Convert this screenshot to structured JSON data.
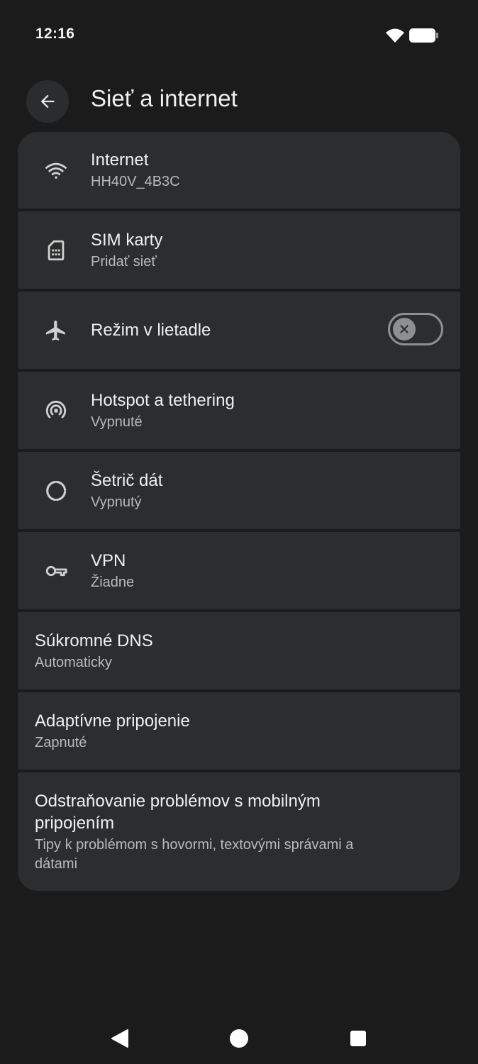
{
  "status_bar": {
    "time": "12:16",
    "wifi_icon": "wifi-icon",
    "battery_icon": "battery-icon"
  },
  "app_bar": {
    "back_icon": "arrow-back-icon",
    "title": "Sieť a internet"
  },
  "items": [
    {
      "icon": "wifi-icon",
      "title": "Internet",
      "subtitle": "HH40V_4B3C"
    },
    {
      "icon": "sim-card-icon",
      "title": "SIM karty",
      "subtitle": "Pridať sieť"
    },
    {
      "icon": "airplane-icon",
      "title": "Režim v lietadle",
      "toggle": "off"
    },
    {
      "icon": "hotspot-icon",
      "title": "Hotspot a tethering",
      "subtitle": "Vypnuté"
    },
    {
      "icon": "data-saver-icon",
      "title": "Šetrič dát",
      "subtitle": "Vypnutý"
    },
    {
      "icon": "vpn-key-icon",
      "title": "VPN",
      "subtitle": "Žiadne"
    },
    {
      "title": "Súkromné DNS",
      "subtitle": "Automaticky"
    },
    {
      "title": "Adaptívne pripojenie",
      "subtitle": "Zapnuté"
    },
    {
      "title": "Odstraňovanie problémov s mobilným pripojením",
      "subtitle": "Tipy k problémom s hovormi, textovými správami a dátami"
    }
  ],
  "colors": {
    "background": "#1b1b1c",
    "card": "#2c2d2e",
    "text_primary": "#f0f0f0",
    "text_secondary": "#b9b9b9",
    "toggle_off": "#8d8f91"
  },
  "nav_bar": {
    "back_icon": "nav-back-icon",
    "home_icon": "nav-home-icon",
    "recents_icon": "nav-recents-icon"
  }
}
